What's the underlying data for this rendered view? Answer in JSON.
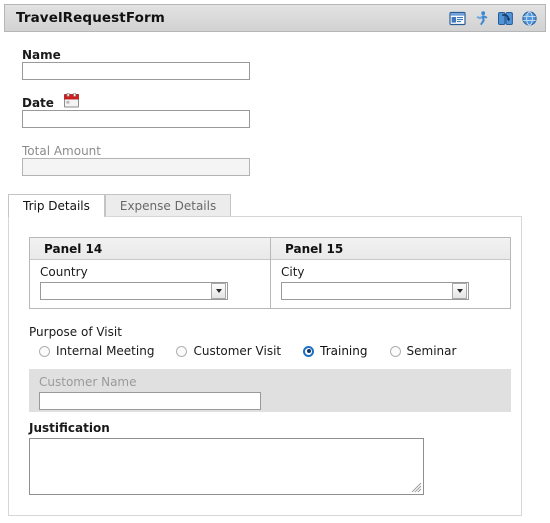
{
  "window": {
    "title": "TravelRequestForm",
    "icons": [
      {
        "name": "form-preview-icon",
        "label": "Preview form"
      },
      {
        "name": "run-icon",
        "label": "Run"
      },
      {
        "name": "refresh-icon",
        "label": "Refresh"
      },
      {
        "name": "globe-icon",
        "label": "Open in browser"
      }
    ]
  },
  "form": {
    "name": {
      "label": "Name",
      "value": "",
      "placeholder": ""
    },
    "date": {
      "label": "Date",
      "value": "",
      "placeholder": "",
      "icon": "calendar-icon"
    },
    "total_amount": {
      "label": "Total Amount",
      "value": "",
      "placeholder": "",
      "disabled": true
    }
  },
  "tabs": [
    {
      "label": "Trip Details",
      "active": true
    },
    {
      "label": "Expense Details",
      "active": false
    }
  ],
  "trip_details": {
    "panels": [
      {
        "header": "Panel 14",
        "field": {
          "label": "Country",
          "value": "",
          "type": "combobox"
        }
      },
      {
        "header": "Panel 15",
        "field": {
          "label": "City",
          "value": "",
          "type": "combobox"
        }
      }
    ],
    "purpose_of_visit": {
      "label": "Purpose of Visit",
      "options": [
        {
          "label": "Internal Meeting",
          "checked": false
        },
        {
          "label": "Customer Visit",
          "checked": false
        },
        {
          "label": "Training",
          "checked": true
        },
        {
          "label": "Seminar",
          "checked": false
        }
      ]
    },
    "customer_name": {
      "label": "Customer Name",
      "value": "",
      "placeholder": "",
      "disabled": true
    },
    "justification": {
      "label": "Justification",
      "value": "",
      "placeholder": ""
    }
  },
  "colors": {
    "titlebar_bg": "#dadada",
    "titlebar_border": "#b6b6b6",
    "accent_blue": "#1f6fc4",
    "calendar_red": "#d21f1f",
    "disabled_bg": "#e0e0e0",
    "disabled_text": "#9a9a9a",
    "panel_header_bg": "#ececec",
    "tab_inactive_bg": "#ececec",
    "tab_inactive_text": "#686868",
    "body_bg": "#ffffff"
  }
}
